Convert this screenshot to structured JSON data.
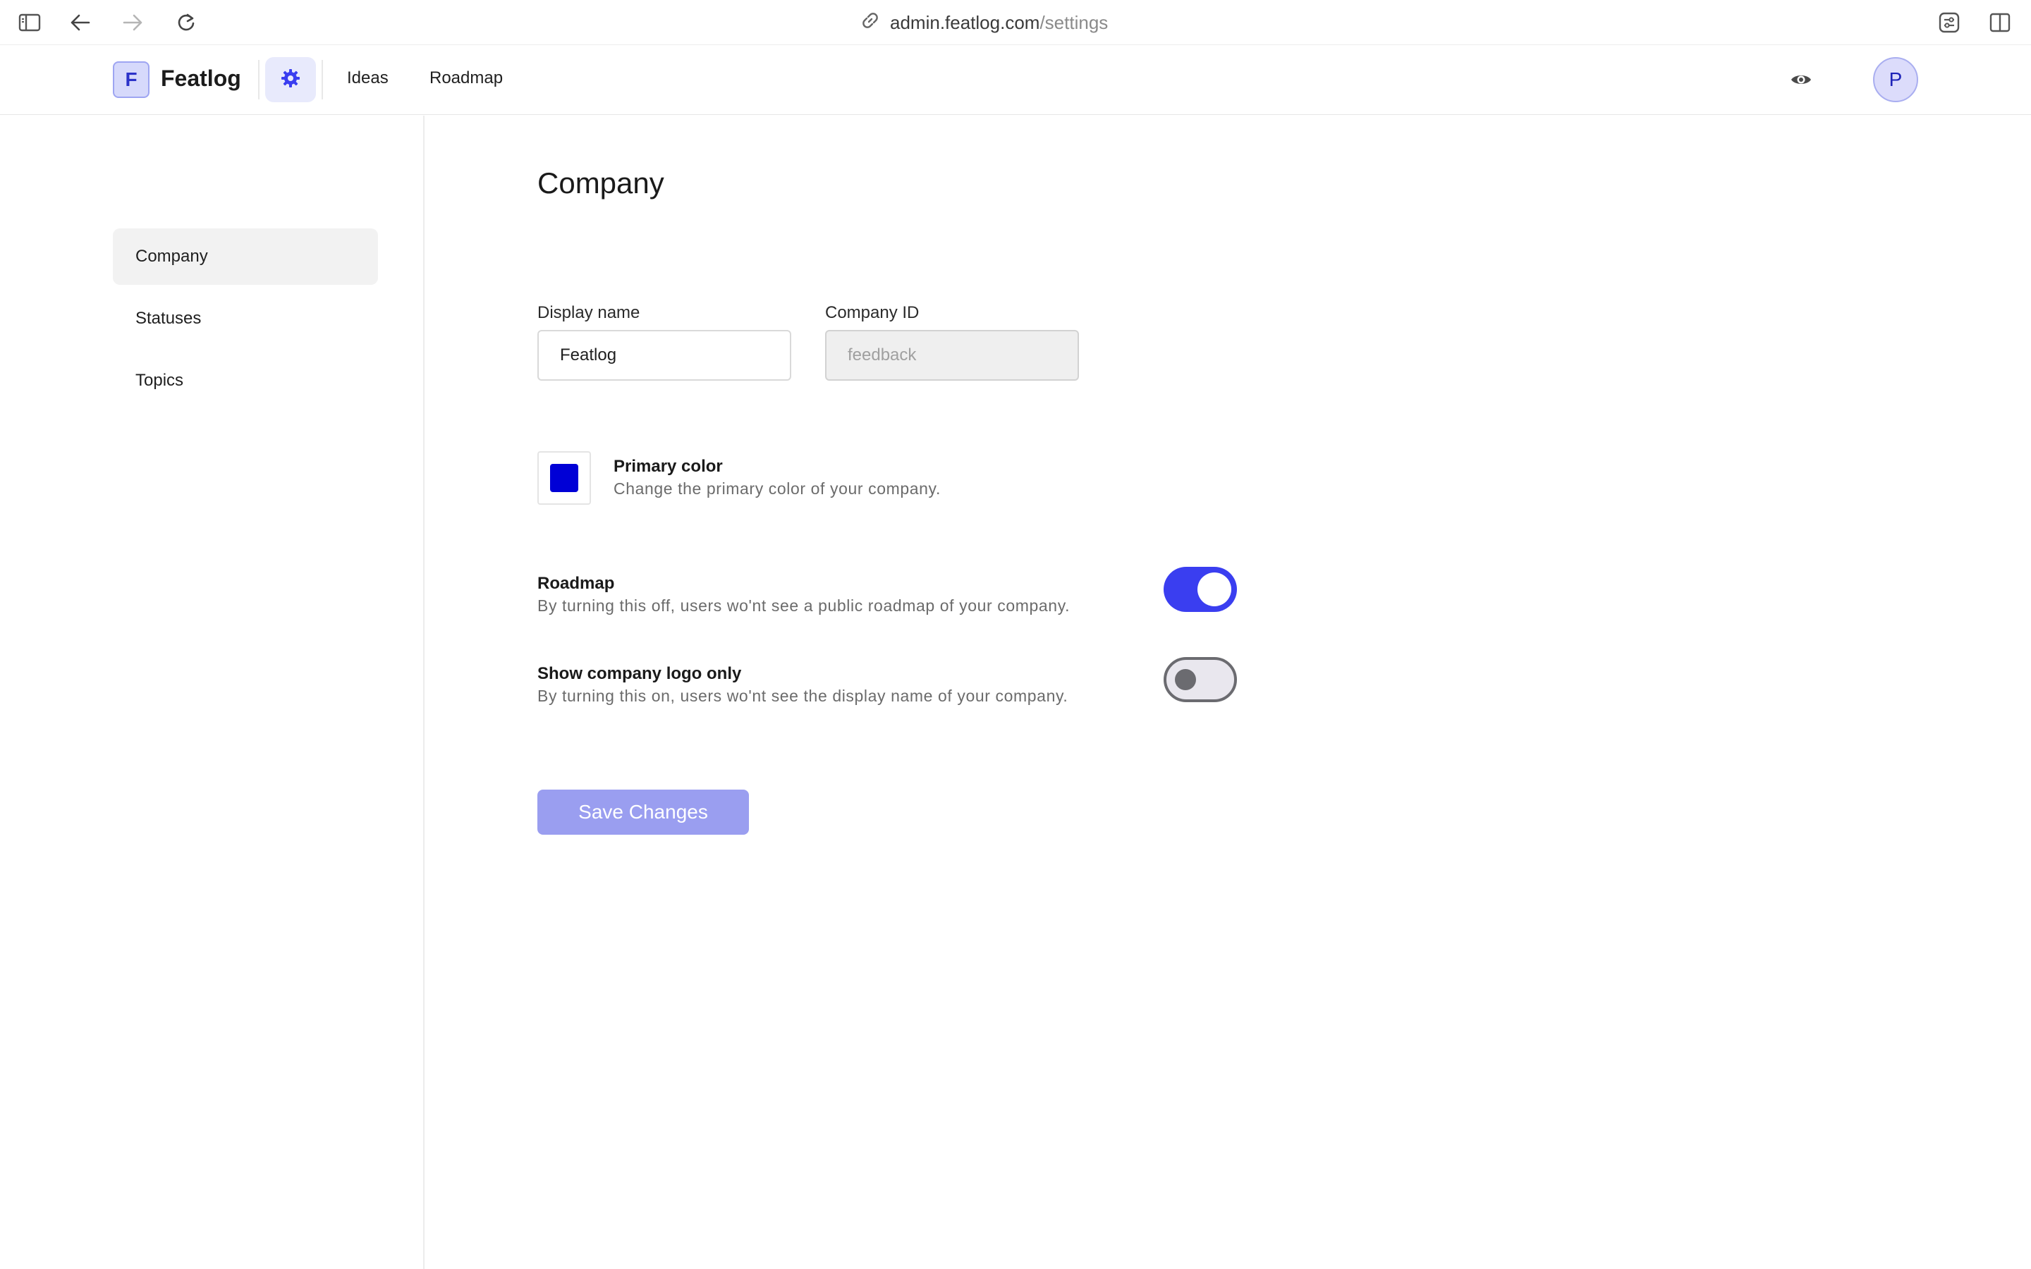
{
  "browser": {
    "url_host": "admin.featlog.com",
    "url_path": "/settings"
  },
  "header": {
    "logo_letter": "F",
    "brand": "Featlog",
    "nav": [
      "Ideas",
      "Roadmap"
    ],
    "avatar_letter": "P"
  },
  "sidebar": {
    "items": [
      {
        "label": "Company",
        "active": true
      },
      {
        "label": "Statuses",
        "active": false
      },
      {
        "label": "Topics",
        "active": false
      }
    ]
  },
  "main": {
    "title": "Company",
    "display_name": {
      "label": "Display name",
      "value": "Featlog"
    },
    "company_id": {
      "label": "Company ID",
      "value": "feedback"
    },
    "primary_color": {
      "title": "Primary color",
      "description": "Change the primary color of your company.",
      "color": "#0000d6"
    },
    "roadmap": {
      "title": "Roadmap",
      "description": "By turning this off, users wo'nt see a public roadmap of your company.",
      "enabled": true
    },
    "logo_only": {
      "title": "Show company logo only",
      "description": "By turning this on, users wo'nt see the display name of your company.",
      "enabled": false
    },
    "save_label": "Save Changes"
  },
  "colors": {
    "accent": "#3a3ef0",
    "accent_light": "#9a9ef0"
  }
}
